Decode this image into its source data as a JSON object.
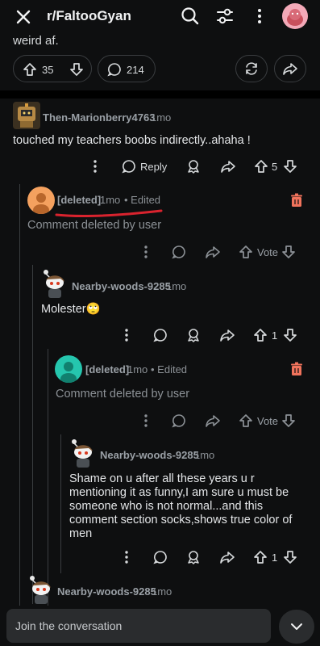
{
  "header": {
    "subreddit": "r/FaltooGyan"
  },
  "post": {
    "tail_text": "weird af.",
    "upvotes": "35",
    "comments_count": "214"
  },
  "comments": [
    {
      "author": "Then-Marionberry4763",
      "age": "1mo",
      "body": "touched my teachers boobs indirectly..ahaha !",
      "reply_label": "Reply",
      "score": "5"
    },
    {
      "author": "[deleted]",
      "age": "1mo",
      "edited": "• Edited",
      "body": "Comment deleted by user",
      "vote_label": "Vote"
    },
    {
      "author": "Nearby-woods-9285",
      "age": "1mo",
      "body": "Molester",
      "emoji": "🙄",
      "score": "1"
    },
    {
      "author": "[deleted]",
      "age": "1mo",
      "edited": "• Edited",
      "body": "Comment deleted by user",
      "vote_label": "Vote"
    },
    {
      "author": "Nearby-woods-9285",
      "age": "1mo",
      "body_lines": [
        "Shame on u after all these years u r",
        "mentioning it as funny,I am sure u must be",
        "someone who is not normal...and this",
        "comment section socks,shows true color of",
        "men"
      ],
      "score": "1"
    },
    {
      "author": "Nearby-woods-9285",
      "age": "1mo"
    }
  ],
  "composer": {
    "placeholder": "Join the conversation"
  },
  "colors": {
    "annotation_underline": "#d9232e",
    "delete_icon": "#f0735c",
    "avatar_orange": "#f4a15f",
    "avatar_teal": "#25c6ae",
    "avatar_pink": "#f3a9b8"
  }
}
